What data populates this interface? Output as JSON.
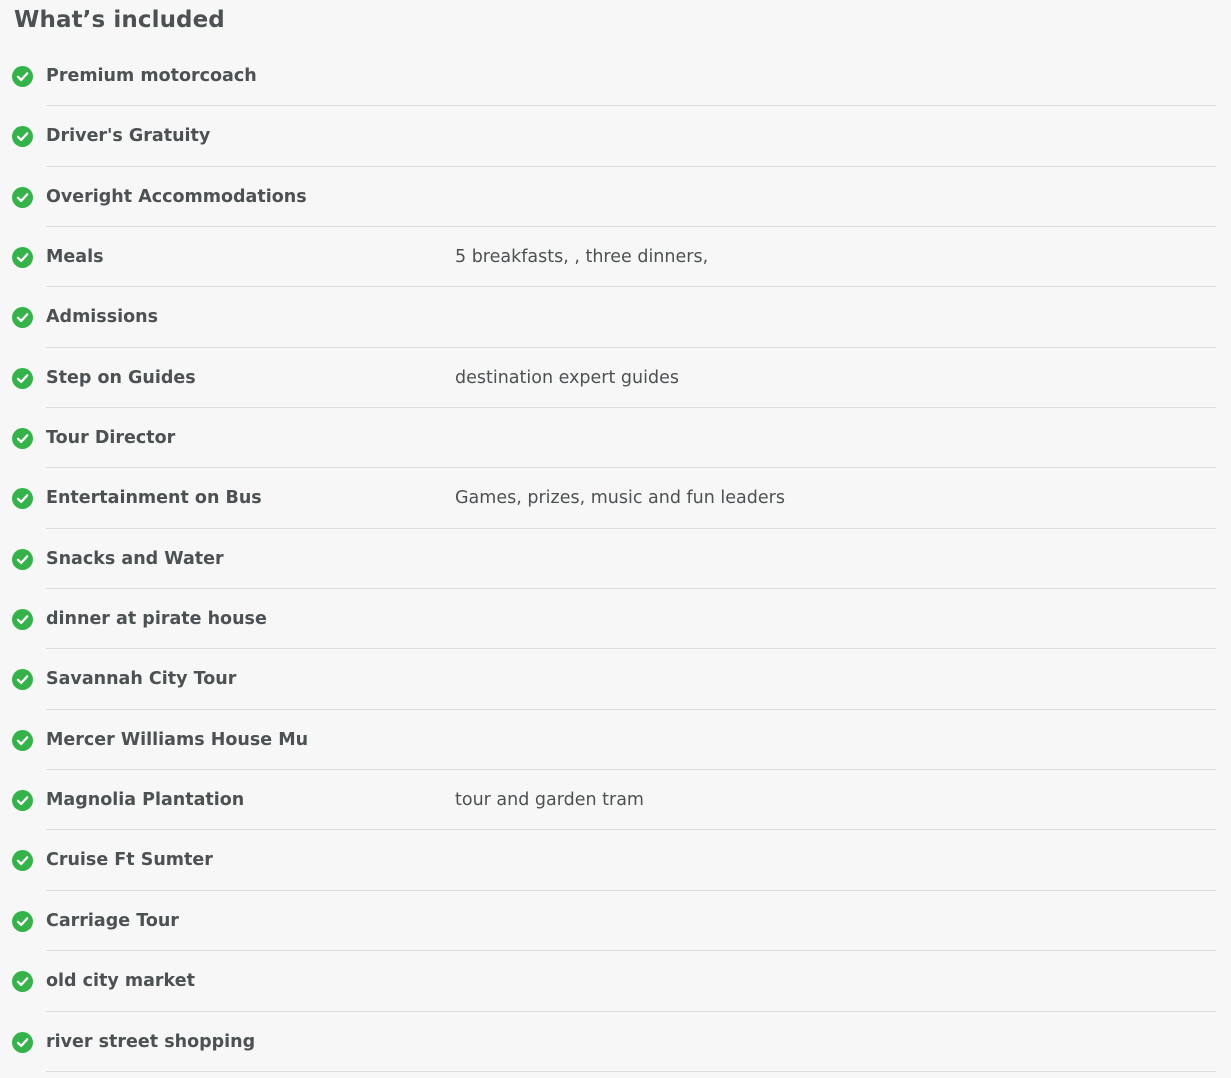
{
  "section": {
    "title": "What’s included"
  },
  "icons": {
    "included": "check-circle-icon"
  },
  "colors": {
    "check": "#35b34a",
    "text": "#4c5153",
    "divider": "#dddddd",
    "background": "#f7f7f7"
  },
  "items": [
    {
      "label": "Premium motorcoach",
      "detail": ""
    },
    {
      "label": "Driver's Gratuity",
      "detail": ""
    },
    {
      "label": "Overight Accommodations",
      "detail": ""
    },
    {
      "label": "Meals",
      "detail": "5 breakfasts, , three dinners,"
    },
    {
      "label": "Admissions",
      "detail": ""
    },
    {
      "label": "Step on Guides",
      "detail": "destination expert guides"
    },
    {
      "label": "Tour Director",
      "detail": ""
    },
    {
      "label": "Entertainment on Bus",
      "detail": "Games, prizes, music and fun leaders"
    },
    {
      "label": "Snacks and Water",
      "detail": ""
    },
    {
      "label": "dinner at pirate house",
      "detail": ""
    },
    {
      "label": "Savannah City Tour",
      "detail": ""
    },
    {
      "label": "Mercer Williams House Mu",
      "detail": ""
    },
    {
      "label": "Magnolia Plantation",
      "detail": "tour and garden tram"
    },
    {
      "label": "Cruise Ft Sumter",
      "detail": ""
    },
    {
      "label": "Carriage Tour",
      "detail": ""
    },
    {
      "label": "old city market",
      "detail": ""
    },
    {
      "label": "river street shopping",
      "detail": ""
    }
  ]
}
